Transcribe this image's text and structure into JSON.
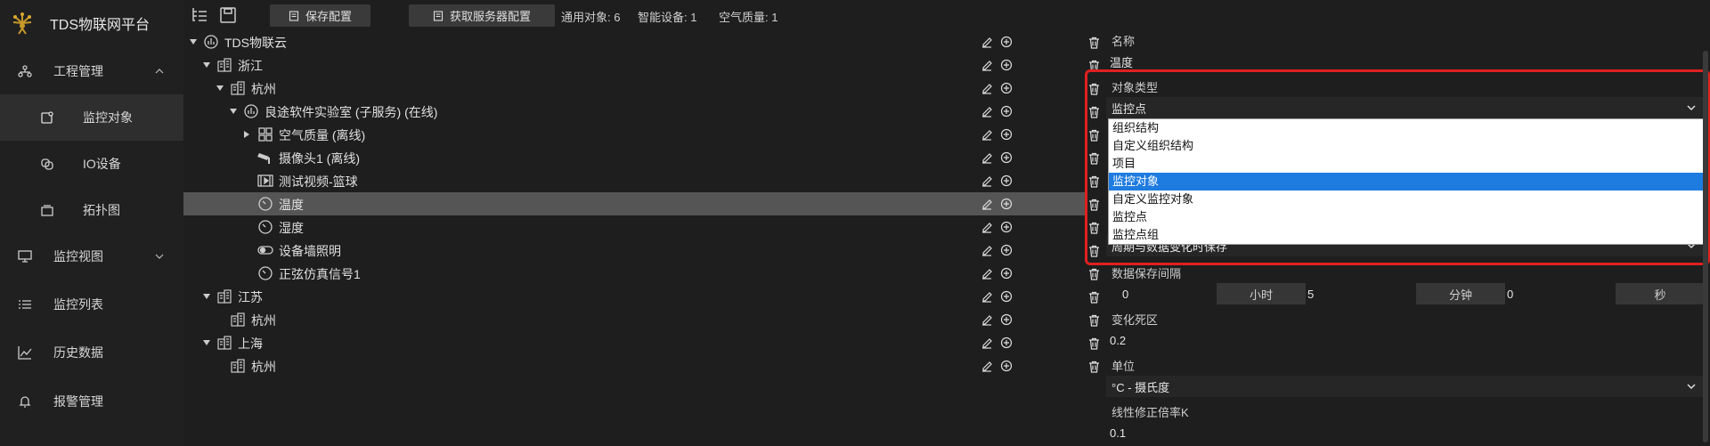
{
  "app": {
    "title": "TDS物联网平台"
  },
  "sidebar": {
    "items": [
      {
        "label": "工程管理",
        "icon": "project-icon",
        "expanded": true
      },
      {
        "label": "监控对象",
        "icon": "monitor-object-icon",
        "active": true
      },
      {
        "label": "IO设备",
        "icon": "io-device-icon"
      },
      {
        "label": "拓扑图",
        "icon": "topology-icon"
      },
      {
        "label": "监控视图",
        "icon": "monitor-view-icon",
        "expanded": false
      },
      {
        "label": "监控列表",
        "icon": "list-icon"
      },
      {
        "label": "历史数据",
        "icon": "chart-line-icon"
      },
      {
        "label": "报警管理",
        "icon": "bell-icon"
      }
    ]
  },
  "toolbar": {
    "save_label": "保存配置",
    "fetch_label": "获取服务器配置",
    "stats": [
      "通用对象: 6",
      "智能设备: 1",
      "空气质量: 1"
    ]
  },
  "tree": {
    "nodes": [
      {
        "label": "TDS物联云",
        "icon": "cloud-org-icon"
      },
      {
        "label": "浙江",
        "icon": "building-icon"
      },
      {
        "label": "杭州",
        "icon": "building-icon"
      },
      {
        "label": "良途软件实验室 (子服务) (在线)",
        "icon": "server-icon"
      },
      {
        "label": "空气质量 (离线)",
        "icon": "device-group-icon"
      },
      {
        "label": "摄像头1 (离线)",
        "icon": "camera-icon"
      },
      {
        "label": "测试视频-篮球",
        "icon": "video-icon"
      },
      {
        "label": "温度",
        "icon": "gauge-icon",
        "selected": true
      },
      {
        "label": "湿度",
        "icon": "gauge-icon"
      },
      {
        "label": "设备墙照明",
        "icon": "switch-icon"
      },
      {
        "label": "正弦仿真信号1",
        "icon": "gauge-icon"
      },
      {
        "label": "江苏",
        "icon": "building-icon"
      },
      {
        "label": "杭州",
        "icon": "building-icon"
      },
      {
        "label": "上海",
        "icon": "building-icon"
      },
      {
        "label": "杭州",
        "icon": "building-icon"
      }
    ]
  },
  "props": {
    "name_label": "名称",
    "name_value": "温度",
    "type_label": "对象类型",
    "type_value": "监控点",
    "type_options": [
      "组织结构",
      "自定义组织结构",
      "项目",
      "监控对象",
      "自定义监控对象",
      "监控点",
      "监控点组"
    ],
    "type_highlighted": "监控对象",
    "save_mode_value": "周期与数据变化时保存",
    "interval_label": "数据保存间隔",
    "interval": [
      {
        "value": "0",
        "unit": "小时"
      },
      {
        "value": "5",
        "unit": "分钟"
      },
      {
        "value": "0",
        "unit": "秒"
      }
    ],
    "deadband_label": "变化死区",
    "deadband_value": "0.2",
    "unit_label": "单位",
    "unit_value": "°C - 摄氏度",
    "coef_label": "线性修正倍率K",
    "coef_value": "0.1"
  },
  "colors": {
    "accent": "#1e7be0",
    "highlight_box": "#e02020",
    "selected_row": "#555555"
  }
}
